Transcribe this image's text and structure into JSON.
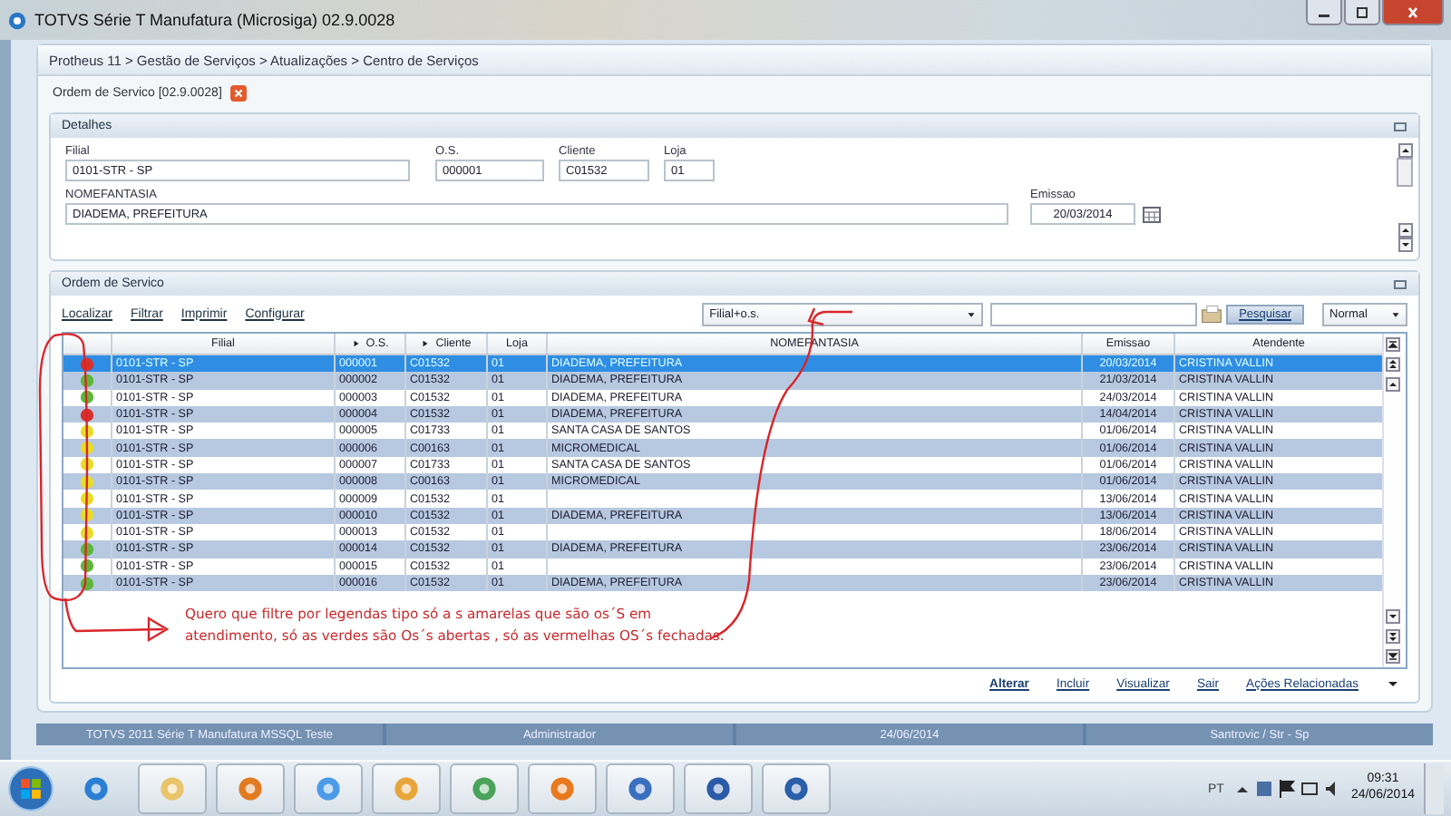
{
  "window": {
    "title": "TOTVS Série T Manufatura (Microsiga) 02.9.0028"
  },
  "breadcrumb": "Protheus 11 > Gestão de Serviços > Atualizações > Centro de Serviços",
  "tab": {
    "label": "Ordem de Servico [02.9.0028]"
  },
  "details": {
    "title": "Detalhes",
    "fields": [
      {
        "label": "Filial",
        "value": "0101-STR - SP"
      },
      {
        "label": "O.S.",
        "value": "000001"
      },
      {
        "label": "Cliente",
        "value": "C01532"
      },
      {
        "label": "Loja",
        "value": "01"
      }
    ],
    "nome": {
      "label": "NOMEFANTASIA",
      "value": "DIADEMA, PREFEITURA"
    },
    "emissao": {
      "label": "Emissao",
      "value": "20/03/2014"
    }
  },
  "orders": {
    "title": "Ordem de Servico",
    "links": [
      "Localizar",
      "Filtrar",
      "Imprimir",
      "Configurar"
    ],
    "index": "Filial+o.s.",
    "search_button": "Pesquisar",
    "mode": "Normal",
    "columns": [
      {
        "label": "Filial",
        "sort": false
      },
      {
        "label": "O.S.",
        "sort": true
      },
      {
        "label": "Cliente",
        "sort": true
      },
      {
        "label": "Loja",
        "sort": false
      },
      {
        "label": "NOMEFANTASIA",
        "sort": false
      },
      {
        "label": "Emissao",
        "sort": false
      },
      {
        "label": "Atendente",
        "sort": false
      }
    ],
    "rows": [
      {
        "color": "#d9302c",
        "selected": true,
        "filial": "0101-STR - SP",
        "os": "000001",
        "cliente": "C01532",
        "loja": "01",
        "nome": "DIADEMA, PREFEITURA",
        "emissao": "20/03/2014",
        "atendente": "CRISTINA VALLIN"
      },
      {
        "color": "#5cb83a",
        "selected": false,
        "filial": "0101-STR - SP",
        "os": "000002",
        "cliente": "C01532",
        "loja": "01",
        "nome": "DIADEMA, PREFEITURA",
        "emissao": "21/03/2014",
        "atendente": "CRISTINA VALLIN"
      },
      {
        "color": "#5cb83a",
        "selected": false,
        "filial": "0101-STR - SP",
        "os": "000003",
        "cliente": "C01532",
        "loja": "01",
        "nome": "DIADEMA, PREFEITURA",
        "emissao": "24/03/2014",
        "atendente": "CRISTINA VALLIN"
      },
      {
        "color": "#d9302c",
        "selected": false,
        "filial": "0101-STR - SP",
        "os": "000004",
        "cliente": "C01532",
        "loja": "01",
        "nome": "DIADEMA, PREFEITURA",
        "emissao": "14/04/2014",
        "atendente": "CRISTINA VALLIN"
      },
      {
        "color": "#e8dc2a",
        "selected": false,
        "filial": "0101-STR - SP",
        "os": "000005",
        "cliente": "C01733",
        "loja": "01",
        "nome": "SANTA CASA DE SANTOS",
        "emissao": "01/06/2014",
        "atendente": "CRISTINA VALLIN"
      },
      {
        "color": "#e8dc2a",
        "selected": false,
        "filial": "0101-STR - SP",
        "os": "000006",
        "cliente": "C00163",
        "loja": "01",
        "nome": "MICROMEDICAL",
        "emissao": "01/06/2014",
        "atendente": "CRISTINA VALLIN"
      },
      {
        "color": "#e8dc2a",
        "selected": false,
        "filial": "0101-STR - SP",
        "os": "000007",
        "cliente": "C01733",
        "loja": "01",
        "nome": "SANTA CASA DE SANTOS",
        "emissao": "01/06/2014",
        "atendente": "CRISTINA VALLIN"
      },
      {
        "color": "#e8dc2a",
        "selected": false,
        "filial": "0101-STR - SP",
        "os": "000008",
        "cliente": "C00163",
        "loja": "01",
        "nome": "MICROMEDICAL",
        "emissao": "01/06/2014",
        "atendente": "CRISTINA VALLIN"
      },
      {
        "color": "#e8dc2a",
        "selected": false,
        "filial": "0101-STR - SP",
        "os": "000009",
        "cliente": "C01532",
        "loja": "01",
        "emissao": "13/06/2014",
        "atendente": "CRISTINA VALLIN"
      },
      {
        "color": "#e8dc2a",
        "selected": false,
        "filial": "0101-STR - SP",
        "os": "000010",
        "cliente": "C01532",
        "loja": "01",
        "nome": "DIADEMA, PREFEITURA",
        "emissao": "13/06/2014",
        "atendente": "CRISTINA VALLIN"
      },
      {
        "color": "#e8dc2a",
        "selected": false,
        "filial": "0101-STR - SP",
        "os": "000013",
        "cliente": "C01532",
        "loja": "01",
        "emissao": "18/06/2014",
        "atendente": "CRISTINA VALLIN"
      },
      {
        "color": "#5cb83a",
        "selected": false,
        "filial": "0101-STR - SP",
        "os": "000014",
        "cliente": "C01532",
        "loja": "01",
        "nome": "DIADEMA, PREFEITURA",
        "emissao": "23/06/2014",
        "atendente": "CRISTINA VALLIN"
      },
      {
        "color": "#5cb83a",
        "selected": false,
        "filial": "0101-STR - SP",
        "os": "000015",
        "cliente": "C01532",
        "loja": "01",
        "emissao": "23/06/2014",
        "atendente": "CRISTINA VALLIN"
      },
      {
        "color": "#5cb83a",
        "selected": false,
        "filial": "0101-STR - SP",
        "os": "000016",
        "cliente": "C01532",
        "loja": "01",
        "nome": "DIADEMA, PREFEITURA",
        "emissao": "23/06/2014",
        "atendente": "CRISTINA VALLIN"
      }
    ],
    "actions": [
      {
        "label": "Alterar",
        "primary": true
      },
      {
        "label": "Incluir",
        "primary": false
      },
      {
        "label": "Visualizar",
        "primary": false
      },
      {
        "label": "Sair",
        "primary": false
      },
      {
        "label": "Ações Relacionadas",
        "primary": false
      }
    ]
  },
  "annotation": {
    "lines": [
      "Quero que filtre por  legendas  tipo só a s amarelas que são os´S  em",
      "atendimento,  só as verdes são Os´s abertas , só as vermelhas OS´s fechadas."
    ]
  },
  "status_bar": [
    "TOTVS 2011 Série T Manufatura MSSQL Teste",
    "Administrador",
    "24/06/2014",
    "Santrovic / Str - Sp"
  ],
  "taskbar": {
    "language": "PT",
    "time": "09:31",
    "date": "24/06/2014"
  }
}
